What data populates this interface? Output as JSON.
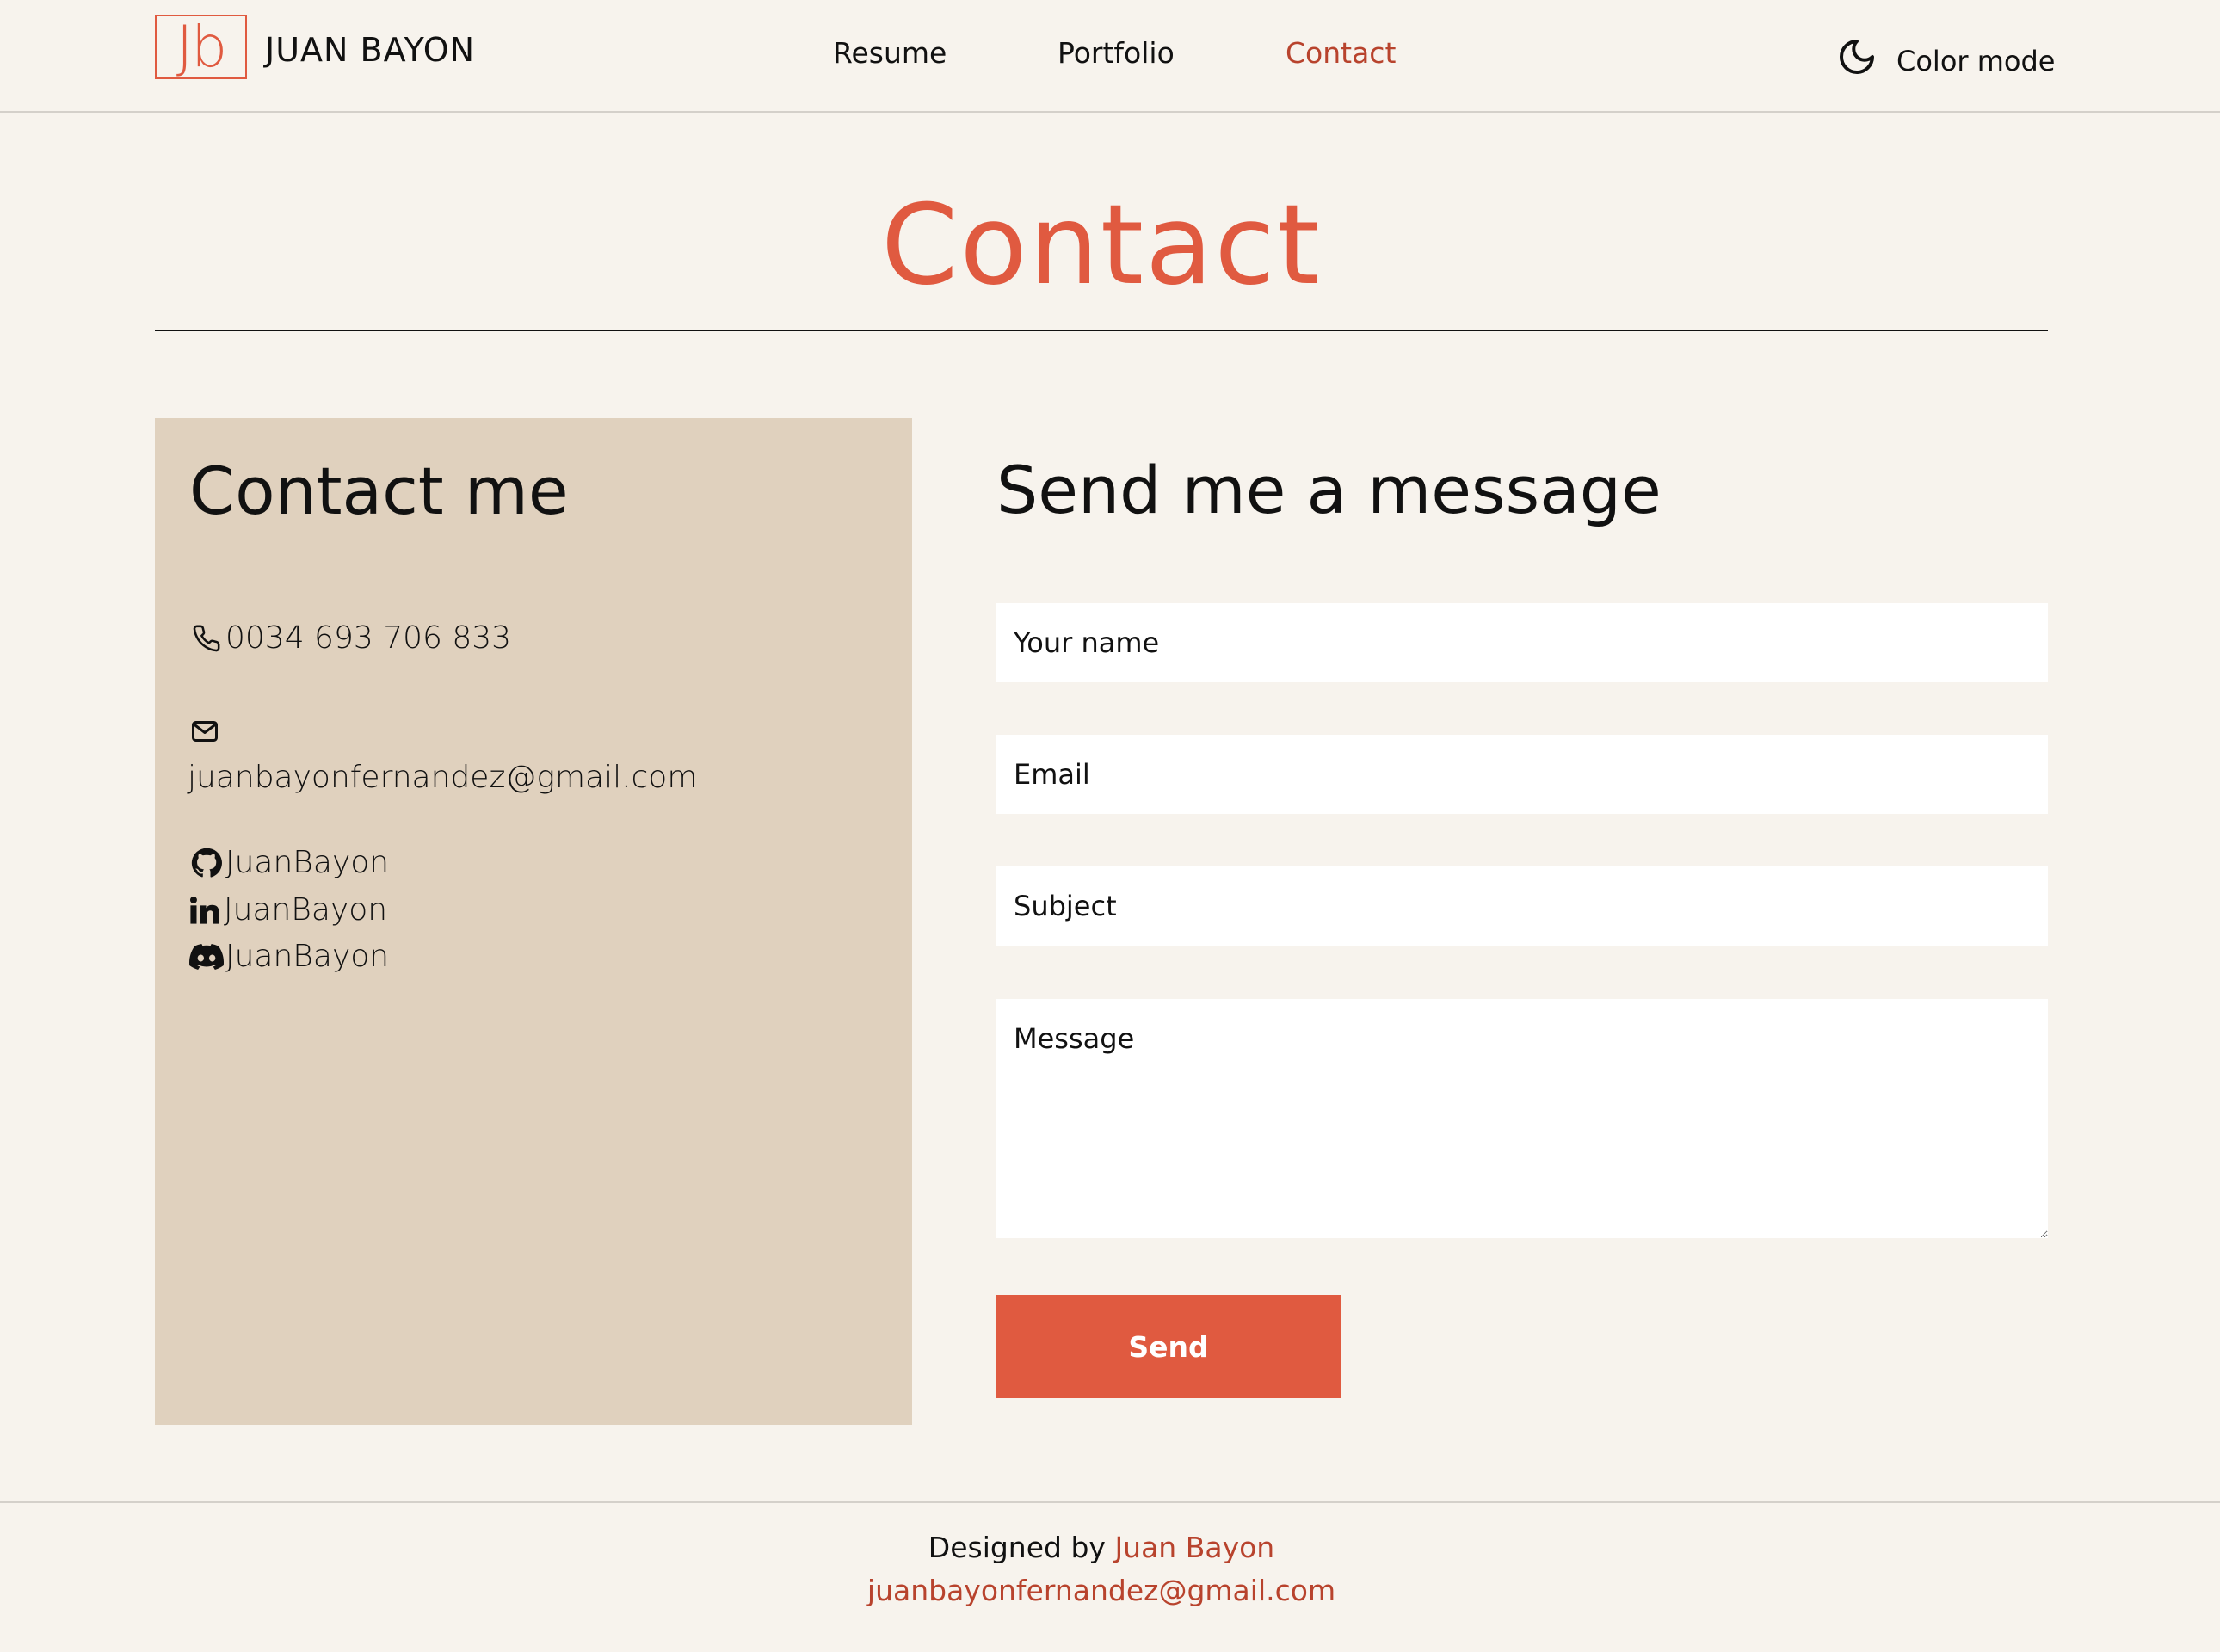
{
  "colors": {
    "accent": "#e05a40",
    "link": "#b8432d",
    "background": "#f7f3ed",
    "card": "#e0d1be",
    "text": "#111111"
  },
  "header": {
    "logo_text": "Jb",
    "brand_name": "JUAN BAYON",
    "nav": [
      {
        "label": "Resume",
        "active": false
      },
      {
        "label": "Portfolio",
        "active": false
      },
      {
        "label": "Contact",
        "active": true
      }
    ],
    "color_mode": {
      "label": "Color mode",
      "icon": "moon-icon"
    }
  },
  "page": {
    "title": "Contact"
  },
  "contact_card": {
    "title": "Contact me",
    "phone": {
      "icon": "phone-icon",
      "value": "0034 693 706 833"
    },
    "email": {
      "icon": "mail-icon",
      "value": "juanbayonfernandez@gmail.com"
    },
    "socials": [
      {
        "icon": "github-icon",
        "label": "JuanBayon"
      },
      {
        "icon": "linkedin-icon",
        "label": "JuanBayon"
      },
      {
        "icon": "discord-icon",
        "label": "JuanBayon"
      }
    ]
  },
  "form": {
    "title": "Send me a message",
    "name_placeholder": "Your name",
    "email_placeholder": "Email",
    "subject_placeholder": "Subject",
    "message_placeholder": "Message",
    "send_label": "Send"
  },
  "footer": {
    "designed_by": "Designed by",
    "author": "Juan Bayon",
    "email": "juanbayonfernandez@gmail.com"
  }
}
